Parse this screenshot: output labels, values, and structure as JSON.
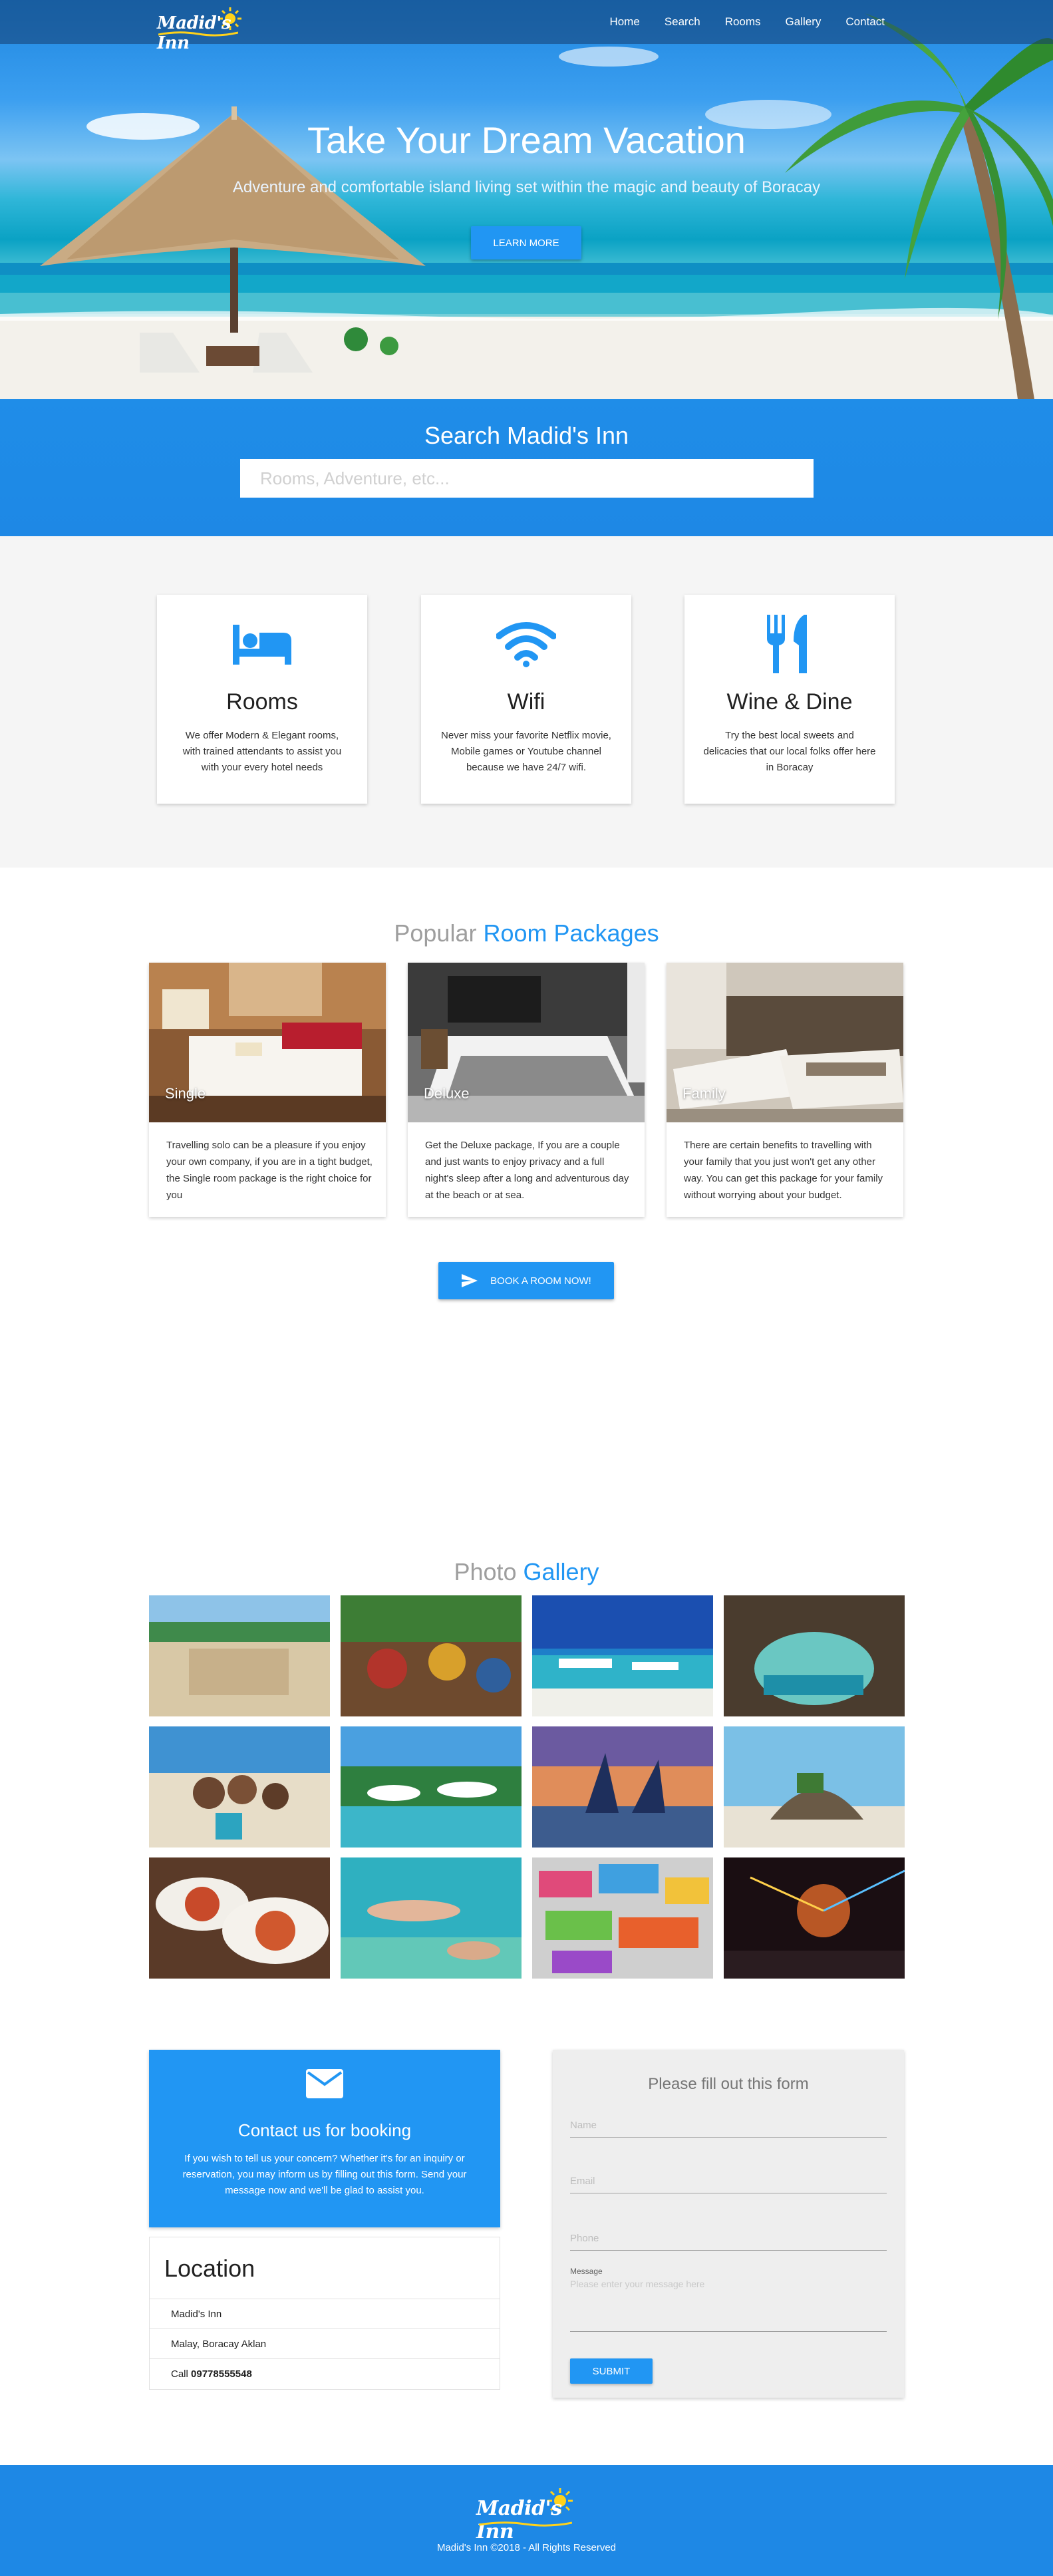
{
  "nav": {
    "brand": "Madid's Inn",
    "links": [
      "Home",
      "Search",
      "Rooms",
      "Gallery",
      "Contact"
    ]
  },
  "hero": {
    "title": "Take Your Dream Vacation",
    "subtitle": "Adventure and comfortable island living set within the magic and beauty of Boracay",
    "button": "LEARN MORE"
  },
  "search": {
    "title": "Search Madid's Inn",
    "placeholder": "Rooms, Adventure, etc..."
  },
  "features": [
    {
      "icon": "bed-icon",
      "title": "Rooms",
      "text": "We offer Modern & Elegant rooms, with trained attendants to assist you with your every hotel needs"
    },
    {
      "icon": "wifi-icon",
      "title": "Wifi",
      "text": "Never miss your favorite Netflix movie, Mobile games or Youtube channel because we have 24/7 wifi."
    },
    {
      "icon": "utensils-icon",
      "title": "Wine & Dine",
      "text": "Try the best local sweets and delicacies that our local folks offer here in Boracay"
    }
  ],
  "packages": {
    "heading_plain": "Popular",
    "heading_accent": "Room Packages",
    "items": [
      {
        "label": "Single",
        "text": "Travelling solo can be a pleasure if you enjoy your own company, if you are in a tight budget, the Single room package is the right choice for you"
      },
      {
        "label": "Deluxe",
        "text": "Get the Deluxe package, If you are a couple and just wants to enjoy privacy and a full night's sleep after a long and adventurous day at the beach or at sea."
      },
      {
        "label": "Family",
        "text": "There are certain benefits to travelling with your family that you just won't get any other way. You can get this package for your family without worrying about your budget."
      }
    ],
    "book_button": "BOOK A ROOM NOW!"
  },
  "gallery": {
    "heading_plain": "Photo",
    "heading_accent": "Gallery",
    "images": [
      "sand-castle",
      "festival-dancers",
      "boats-on-sea",
      "rock-cave",
      "kids-on-beach",
      "beach-resort",
      "sunset-sailboats",
      "rock-shrine",
      "crab-dish",
      "snorkeling",
      "souvenir-signs",
      "night-party"
    ]
  },
  "contact": {
    "title": "Contact us for booking",
    "text": "If you wish to tell us your concern? Whether it's for an inquiry or reservation, you may inform us by filling out this form. Send your message now and we'll be glad to assist you.",
    "location_title": "Location",
    "location_rows": [
      "Madid's Inn",
      "Malay, Boracay Aklan"
    ],
    "call_prefix": "Call",
    "phone": "09778555548"
  },
  "form": {
    "title": "Please fill out this form",
    "name_placeholder": "Name",
    "email_placeholder": "Email",
    "phone_placeholder": "Phone",
    "message_label": "Message",
    "message_placeholder": "Please enter your message here",
    "submit": "SUBMIT"
  },
  "footer": {
    "copyright": "Madid's Inn ©2018 - All Rights Reserved"
  },
  "colors": {
    "primary": "#2196f3",
    "footer": "#1e88e5",
    "muted_heading": "#9e9e9e"
  }
}
